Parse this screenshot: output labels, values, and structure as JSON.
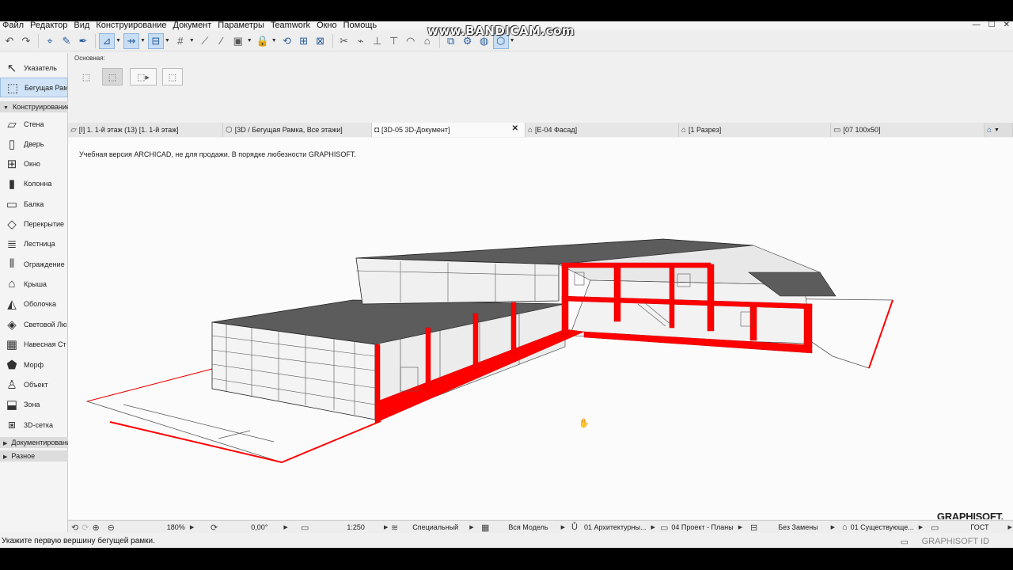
{
  "menu": [
    "Файл",
    "Редактор",
    "Вид",
    "Конструирование",
    "Документ",
    "Параметры",
    "Teamwork",
    "Окно",
    "Помощь"
  ],
  "window_controls": [
    "—",
    "☐",
    "✕"
  ],
  "watermark": "www.BANDICAM.com",
  "infobox": {
    "caption": "Основная:"
  },
  "toolbox": {
    "pointer": "Указатель",
    "marquee": "Бегущая Рамка",
    "group_design": "Конструирование",
    "tools": [
      "Стена",
      "Дверь",
      "Окно",
      "Колонна",
      "Балка",
      "Перекрытие",
      "Лестница",
      "Ограждение",
      "Крыша",
      "Оболочка",
      "Световой Люк",
      "Навесная Стена",
      "Морф",
      "Объект",
      "Зона",
      "3D-сетка"
    ],
    "group_doc": "Документирование",
    "group_misc": "Разное"
  },
  "tabs": [
    {
      "label": "[I] 1. 1-й этаж (13) [1. 1-й этаж]"
    },
    {
      "label": "[3D / Бегущая Рамка, Все этажи]"
    },
    {
      "label": "[3D-05 3D-Документ]"
    },
    {
      "label": "[E-04 Фасад]"
    },
    {
      "label": "[1 Разрез]"
    },
    {
      "label": "[07 100x50]"
    }
  ],
  "viewport": {
    "edu_notice": "Учебная версия ARCHICAD, не для продажи. В порядке любезности GRAPHISOFT.",
    "brand": "GRAPHISOFT."
  },
  "statusbar": {
    "zoom": "180%",
    "angle": "0,00°",
    "scale": "1:250",
    "view": "Специальный",
    "model": "Вся Модель",
    "layers": "01 Архитектурны...",
    "pens": "04 Проект - Планы",
    "override": "Без Замены",
    "renovation": "01 Существующе...",
    "dimension": "ГОСТ"
  },
  "hint": "Укажите первую вершину бегущей рамки.",
  "graphisoft_id": "GRAPHISOFT ID",
  "colors": {
    "section": "#ff0000",
    "roof": "#5a5a5a",
    "select": "#cfe2f6"
  }
}
